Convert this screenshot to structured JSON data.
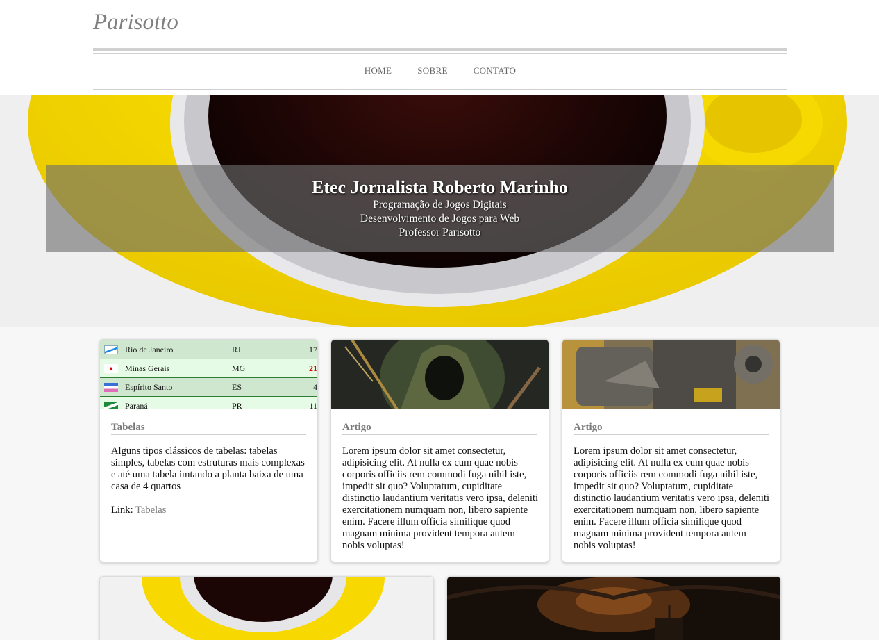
{
  "header": {
    "brand": "Parisotto",
    "nav": [
      "HOME",
      "SOBRE",
      "CONTATO"
    ]
  },
  "hero": {
    "title": "Etec Jornalista Roberto Marinho",
    "lines": [
      "Programação de Jogos Digitais",
      "Desenvolvimento de Jogos para Web",
      "Professor Parisotto"
    ]
  },
  "cards": [
    {
      "title": "Tabelas",
      "text": "Alguns tipos clássicos de tabelas: tabelas simples, tabelas com estruturas mais complexas e até uma tabela imtando a planta baixa de uma casa de 4 quartos",
      "link_prefix": "Link: ",
      "link_label": "Tabelas",
      "table_rows": [
        {
          "state": "Rio de Janeiro",
          "uf": "RJ",
          "num": "17"
        },
        {
          "state": "Minas Gerais",
          "uf": "MG",
          "num": "21"
        },
        {
          "state": "Espírito Santo",
          "uf": "ES",
          "num": "4"
        },
        {
          "state": "Paraná",
          "uf": "PR",
          "num": "11"
        }
      ]
    },
    {
      "title": "Artigo",
      "text": "Lorem ipsum dolor sit amet consectetur, adipisicing elit. At nulla ex cum quae nobis corporis officiis rem commodi fuga nihil iste, impedit sit quo? Voluptatum, cupiditate distinctio laudantium veritatis vero ipsa, deleniti exercitationem numquam non, libero sapiente enim. Facere illum officia similique quod magnam minima provident tempora autem nobis voluptas!"
    },
    {
      "title": "Artigo",
      "text": "Lorem ipsum dolor sit amet consectetur, adipisicing elit. At nulla ex cum quae nobis corporis officiis rem commodi fuga nihil iste, impedit sit quo? Voluptatum, cupiditate distinctio laudantium veritatis vero ipsa, deleniti exercitationem numquam non, libero sapiente enim. Facere illum officia similique quod magnam minima provident tempora autem nobis voluptas!"
    }
  ],
  "colors": {
    "accent_yellow": "#f7d800",
    "brand_gray": "#808080",
    "table_green": "#2e7d32"
  }
}
